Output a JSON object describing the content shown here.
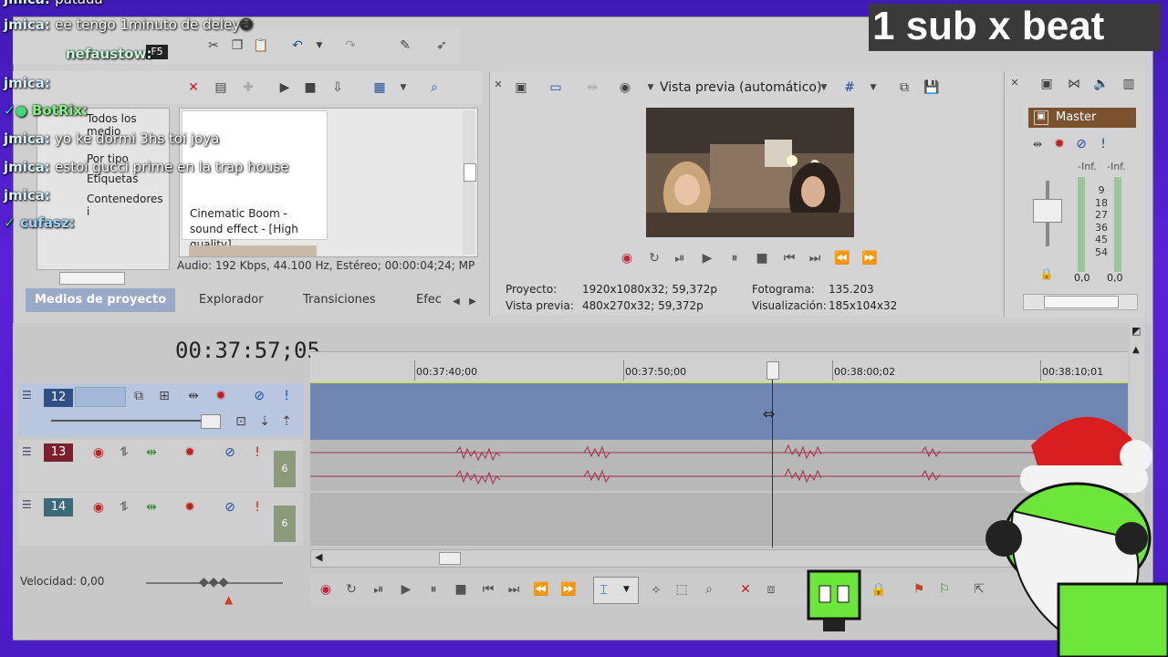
{
  "overlay": {
    "title": "1 sub x beat"
  },
  "chat": [
    {
      "user": "jmica:",
      "msg": "patada"
    },
    {
      "user": "jmica:",
      "msg": "ee tengo 1minuto de deley"
    },
    {
      "user": "nefaustow:",
      "msg": ""
    },
    {
      "user": "jmica:",
      "msg": ""
    },
    {
      "user": "BotRix:",
      "msg": ""
    },
    {
      "user": "jmica:",
      "msg": "yo ke dormi 3hs toi joya"
    },
    {
      "user": "jmica:",
      "msg": "estoi gucci prime en la trap house"
    },
    {
      "user": "jmica:",
      "msg": ""
    },
    {
      "user": "cufasz:",
      "msg": ""
    }
  ],
  "toolbar": {
    "f5": "F5"
  },
  "media": {
    "tree": [
      "Todos los medio",
      "Por tipo",
      "Etiquetas",
      "Contenedores i"
    ],
    "thumb_title": "Cinematic Boom - sound effect - [High quality]...",
    "audio_info": "Audio: 192 Kbps, 44.100 Hz, Estéreo; 00:00:04;24; MP",
    "tabs": [
      "Medios de proyecto",
      "Explorador",
      "Transiciones",
      "Efec"
    ]
  },
  "preview": {
    "mode_label": "Vista previa (automático)",
    "project_label": "Proyecto:",
    "project_value": "1920x1080x32; 59,372p",
    "preview_label": "Vista previa:",
    "preview_value": "480x270x32; 59,372p",
    "frame_label": "Fotograma:",
    "frame_value": "135.203",
    "display_label": "Visualización:",
    "display_value": "185x104x32"
  },
  "mixer": {
    "master_label": "Master",
    "inf_left": "-Inf.",
    "inf_right": "-Inf.",
    "scale": [
      "9",
      "18",
      "27",
      "36",
      "45",
      "54"
    ],
    "zero_left": "0,0",
    "zero_right": "0,0"
  },
  "timeline": {
    "timecode": "00:37:57;05",
    "ruler": [
      "00:37:40;00",
      "00:37:50;00",
      "00:38:00;02",
      "00:38:10;01"
    ],
    "tracks": [
      {
        "num": "12",
        "type": "video"
      },
      {
        "num": "13",
        "type": "audio",
        "level": "6"
      },
      {
        "num": "14",
        "type": "audio",
        "level": "6"
      }
    ],
    "speed": "Velocidad: 0,00"
  },
  "colors": {
    "accent": "#9aa9c8",
    "video_track": "#6f86b2",
    "audio_wave": "#a03050",
    "record": "#c0283a"
  }
}
